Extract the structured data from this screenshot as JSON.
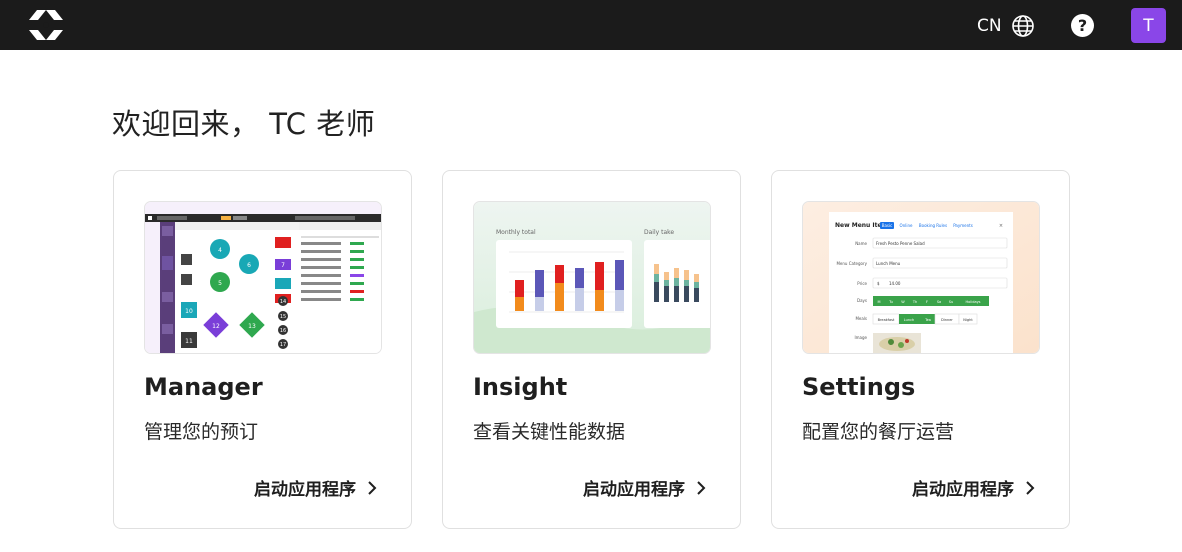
{
  "header": {
    "language": "CN",
    "help_symbol": "?",
    "avatar_initial": "T",
    "icons": {
      "logo": "brand-logo-icon",
      "language": "globe-icon",
      "help": "question-circle-icon"
    }
  },
  "colors": {
    "header_bg": "#1b1b1b",
    "avatar_bg": "#8a46e8",
    "accent_red": "#e02020",
    "accent_blue": "#5b57b8",
    "accent_green": "#3aa34a"
  },
  "greeting": "欢迎回来， TC 老师",
  "cards": [
    {
      "title": "Manager",
      "description": "管理您的预订",
      "launch_label": "启动应用程序",
      "thumbnail": "floor-plan-preview",
      "preview_tables": [
        "4",
        "5",
        "6",
        "8",
        "10",
        "11",
        "12",
        "13",
        "7",
        "14",
        "15",
        "16",
        "17"
      ]
    },
    {
      "title": "Insight",
      "description": "查看关键性能数据",
      "launch_label": "启动应用程序",
      "thumbnail": "chart-preview",
      "preview_labels": {
        "monthly": "Monthly total",
        "daily": "Daily take"
      }
    },
    {
      "title": "Settings",
      "description": "配置您的餐厅运营",
      "launch_label": "启动应用程序",
      "thumbnail": "menu-form-preview",
      "preview_labels": {
        "form_title": "New Menu Item",
        "tabs": [
          "Basic",
          "Online",
          "Booking Rules",
          "Payments"
        ],
        "name_label": "Name",
        "name_value": "Fresh Pesto Penne Salad",
        "category_label": "Menu Category",
        "category_value": "Lunch Menu",
        "price_label": "Price",
        "currency": "$",
        "price_value": "14.00",
        "days_label": "Days",
        "days": [
          "M",
          "Tu",
          "W",
          "Th",
          "F",
          "Sa",
          "Su",
          "Holidays"
        ],
        "meals_label": "Meals",
        "meals": [
          "Breakfast",
          "Lunch",
          "Tea",
          "Dinner",
          "Night"
        ],
        "image_label": "Image"
      }
    }
  ]
}
